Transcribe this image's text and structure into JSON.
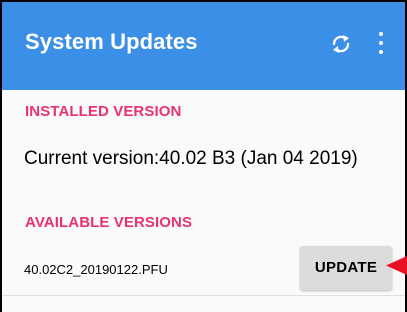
{
  "appbar": {
    "title": "System Updates",
    "sync_icon": "sync-icon",
    "more_icon": "more-vert-icon",
    "color": "#3b8fe6"
  },
  "installed": {
    "header": "INSTALLED VERSION",
    "current_version": "Current version:40.02 B3 (Jan 04 2019)"
  },
  "available": {
    "header": "AVAILABLE VERSIONS",
    "items": [
      {
        "name": "40.02C2_20190122.PFU",
        "button_label": "UPDATE"
      }
    ]
  },
  "annotation": {
    "icon": "red-arrow-icon",
    "color": "#e81123"
  },
  "colors": {
    "section_header": "#e83370",
    "button_bg": "#dcdcdc"
  }
}
